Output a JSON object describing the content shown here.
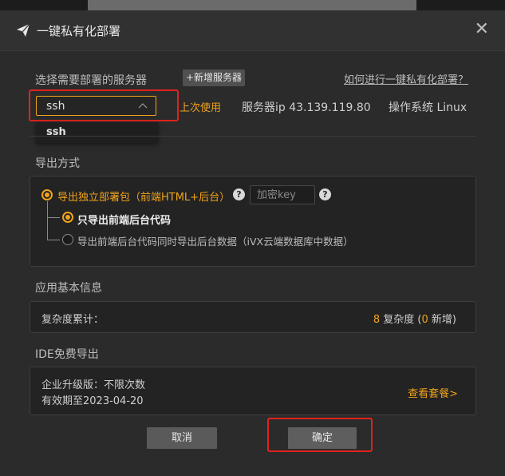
{
  "dialog": {
    "title": "一键私有化部署",
    "close_label": "✕"
  },
  "server_section": {
    "label": "选择需要部署的服务器",
    "add_server_label": "+新增服务器",
    "help_link": "如何进行一键私有化部署？",
    "selected_server": "ssh",
    "dropdown_options": [
      "ssh"
    ],
    "last_used_label": "上次使用",
    "server_ip_text": "服务器ip 43.139.119.80",
    "os_text": "操作系统 Linux"
  },
  "export_section": {
    "label": "导出方式",
    "option_standalone": "导出独立部署包（前端HTML+后台）",
    "key_placeholder": "加密key",
    "sub_option_code_only": "只导出前端后台代码",
    "sub_option_with_data": "导出前端后台代码同时导出后台数据（iVX云端数据库中数据）"
  },
  "app_info": {
    "label": "应用基本信息",
    "complexity_label": "复杂度累计：",
    "complexity_total": "8",
    "complexity_word": "复杂度",
    "paren_open": "(",
    "new_count": "0",
    "new_word": "新增)"
  },
  "ide_section": {
    "label": "IDE免费导出",
    "plan_text": "企业升级版：不限次数",
    "validity_text": "有效期至2023-04-20",
    "view_plan_link": "查看套餐>"
  },
  "buttons": {
    "cancel": "取消",
    "confirm": "确定"
  },
  "colors": {
    "accent": "#f0a31c",
    "highlight_box": "#e0231d"
  }
}
